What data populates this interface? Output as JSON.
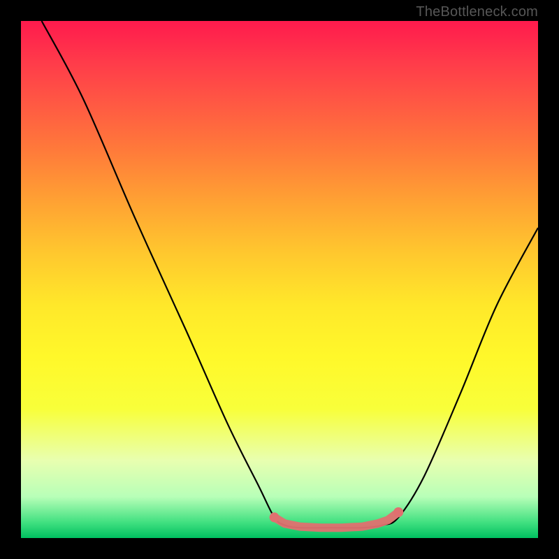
{
  "watermark": "TheBottleneck.com",
  "chart_data": {
    "type": "line",
    "title": "",
    "xlabel": "",
    "ylabel": "",
    "xlim": [
      0,
      100
    ],
    "ylim": [
      0,
      100
    ],
    "background": "rainbow-vertical-gradient",
    "description": "V-shaped bottleneck curve over red-to-green gradient; flat green region at the bottom indicates optimal balance.",
    "curve_points_xy_pct": [
      [
        4,
        100
      ],
      [
        12,
        85
      ],
      [
        22,
        62
      ],
      [
        32,
        40
      ],
      [
        40,
        22
      ],
      [
        46,
        10
      ],
      [
        49,
        4
      ],
      [
        51,
        2.5
      ],
      [
        54,
        2
      ],
      [
        60,
        2
      ],
      [
        66,
        2
      ],
      [
        70,
        2.5
      ],
      [
        73,
        4
      ],
      [
        78,
        12
      ],
      [
        85,
        28
      ],
      [
        92,
        45
      ],
      [
        100,
        60
      ]
    ],
    "optimal_marker_points_xy_pct": [
      [
        49,
        4
      ],
      [
        51,
        2.8
      ],
      [
        54,
        2.2
      ],
      [
        58,
        2
      ],
      [
        62,
        2
      ],
      [
        66,
        2.2
      ],
      [
        69,
        2.8
      ],
      [
        71,
        3.5
      ],
      [
        73,
        5
      ]
    ],
    "marker_color": "#e07070"
  }
}
